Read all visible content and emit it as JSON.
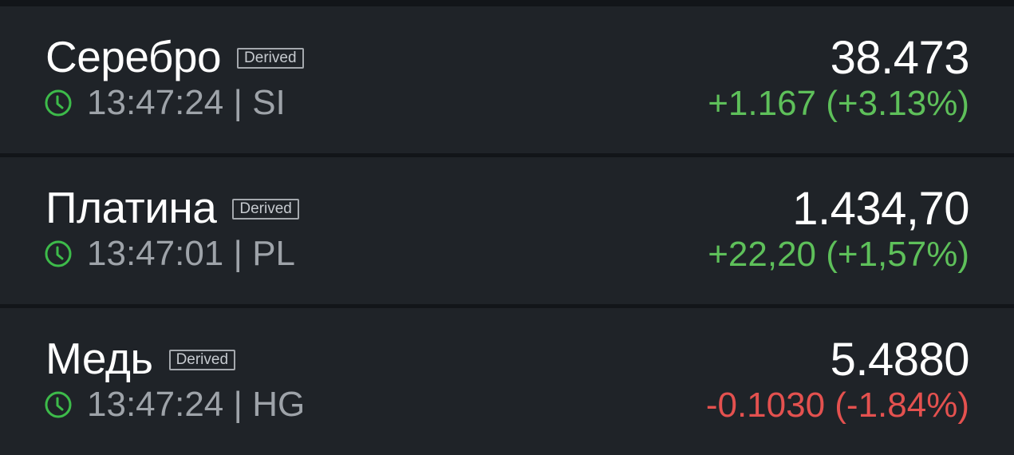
{
  "colors": {
    "background": "#121519",
    "row_background": "#1f2328",
    "positive": "#5ec05a",
    "negative": "#e4514f",
    "clock_icon": "#3dbb4a"
  },
  "rows": [
    {
      "name": "Серебро",
      "badge": "Derived",
      "time": "13:47:24",
      "separator": "|",
      "symbol": "SI",
      "price": "38.473",
      "change": "+1.167 (+3.13%)",
      "direction": "positive",
      "icon": "clock-icon"
    },
    {
      "name": "Платина",
      "badge": "Derived",
      "time": "13:47:01",
      "separator": "|",
      "symbol": "PL",
      "price": "1.434,70",
      "change": "+22,20 (+1,57%)",
      "direction": "positive",
      "icon": "clock-icon"
    },
    {
      "name": "Медь",
      "badge": "Derived",
      "time": "13:47:24",
      "separator": "|",
      "symbol": "HG",
      "price": "5.4880",
      "change": "-0.1030 (-1.84%)",
      "direction": "negative",
      "icon": "clock-icon"
    }
  ]
}
